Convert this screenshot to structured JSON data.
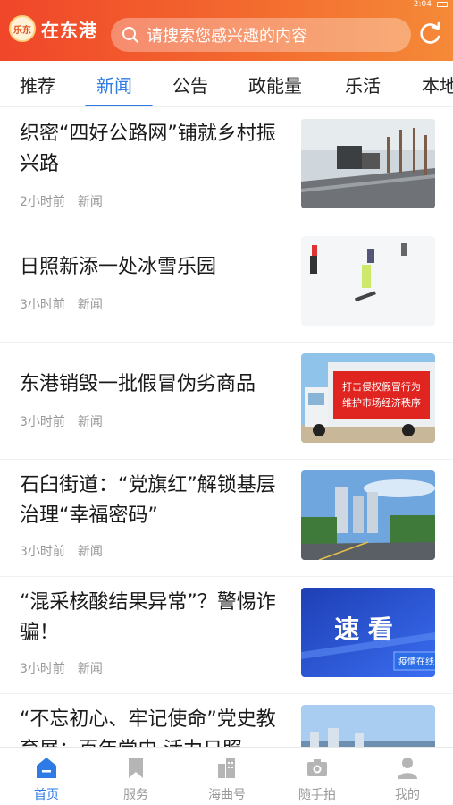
{
  "header": {
    "logo_text": "在东港",
    "logo_mark": "乐东",
    "search_placeholder": "请搜索您感兴趣的内容",
    "status_time": "2:04"
  },
  "tabs": [
    {
      "label": "推荐"
    },
    {
      "label": "新闻"
    },
    {
      "label": "公告"
    },
    {
      "label": "政能量"
    },
    {
      "label": "乐活"
    },
    {
      "label": "本地"
    }
  ],
  "news": [
    {
      "title": "织密“四好公路网”铺就乡村振兴路",
      "time": "2小时前",
      "category": "新闻"
    },
    {
      "title": "日照新添一处冰雪乐园",
      "time": "3小时前",
      "category": "新闻"
    },
    {
      "title": "东港销毁一批假冒伪劣商品",
      "time": "3小时前",
      "category": "新闻",
      "banner": [
        "打击侵权假冒行为",
        "维护市场经济秩序"
      ]
    },
    {
      "title": "石臼街道：“党旗红”解锁基层治理“幸福密码”",
      "time": "3小时前",
      "category": "新闻"
    },
    {
      "title": "“混采核酸结果异常”？警惕诈骗！",
      "time": "3小时前",
      "category": "新闻",
      "thumb_text": "速 看",
      "thumb_badge": "疫情在线"
    },
    {
      "title": "“不忘初心、牢记使命”党史教育展：百年党史 活力日照",
      "time": "",
      "category": ""
    }
  ],
  "bottom_nav": [
    {
      "label": "首页"
    },
    {
      "label": "服务"
    },
    {
      "label": "海曲号"
    },
    {
      "label": "随手拍"
    },
    {
      "label": "我的"
    }
  ],
  "colors": {
    "accent": "#2f7be5",
    "header_start": "#f0462a",
    "header_end": "#f58a38"
  }
}
